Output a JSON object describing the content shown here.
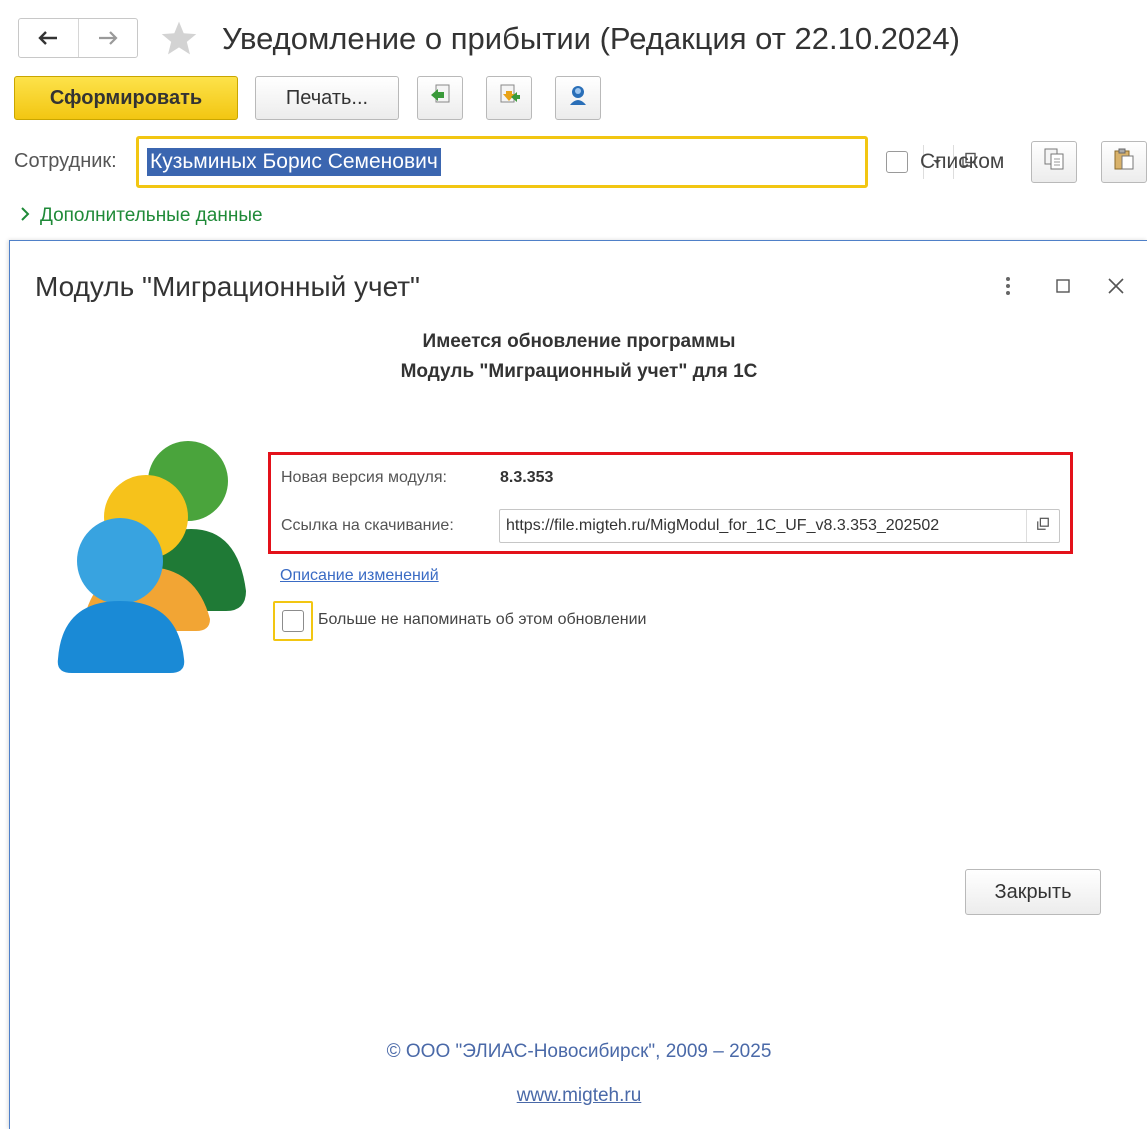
{
  "form": {
    "title": "Уведомление о прибытии (Редакция от 22.10.2024)",
    "toolbar": {
      "generate_label": "Сформировать",
      "print_label": "Печать..."
    },
    "employee": {
      "label": "Сотрудник:",
      "value": "Кузьминых Борис Семенович"
    },
    "list_checkbox_label": "Списком",
    "additional_data_label": "Дополнительные данные"
  },
  "dialog": {
    "title": "Модуль \"Миграционный учет\"",
    "heading_line1": "Имеется обновление программы",
    "heading_line2": "Модуль \"Миграционный учет\" для 1С",
    "new_version_label": "Новая версия модуля:",
    "new_version_value": "8.3.353",
    "download_link_label": "Ссылка на скачивание:",
    "download_link_value": "https://file.migteh.ru/MigModul_for_1C_UF_v8.3.353_202502",
    "changes_link": "Описание изменений",
    "remind_label": "Больше не напоминать об этом обновлении",
    "close_label": "Закрыть",
    "copyright": "© ООО \"ЭЛИАС-Новосибирск\", 2009 – 2025",
    "site": "www.migteh.ru"
  },
  "colors": {
    "primary_button": "#f2c612",
    "highlight_box": "#e3111a",
    "link": "#3a6bc4",
    "additional_data": "#1f8a38",
    "selection": "#3b66b0"
  }
}
